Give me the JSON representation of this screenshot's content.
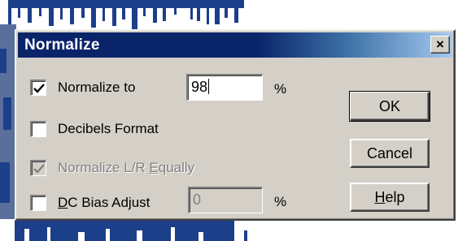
{
  "dialog": {
    "title": "Normalize",
    "close_glyph": "×",
    "normalize_to": {
      "checked": true,
      "label": "Normalize to",
      "value": "98",
      "unit": "%"
    },
    "decibels_format": {
      "checked": false,
      "label": "Decibels Format"
    },
    "normalize_lr_equally": {
      "checked": true,
      "enabled": false,
      "label_pre": "Normalize L/R ",
      "label_accel": "E",
      "label_post": "qually"
    },
    "dc_bias_adjust": {
      "checked": false,
      "label_accel": "D",
      "label_post": "C Bias Adjust",
      "value": "0",
      "unit": "%"
    },
    "buttons": {
      "ok": "OK",
      "cancel": "Cancel",
      "help_accel": "H",
      "help_post": "elp"
    }
  },
  "icons": {
    "checkmark": "check-mark-icon",
    "close": "close-icon"
  },
  "colors": {
    "titlebar_start": "#0a246a",
    "titlebar_end": "#a6caf0",
    "dialog_face": "#d4d0c8",
    "waveform": "#1c3f8a"
  }
}
